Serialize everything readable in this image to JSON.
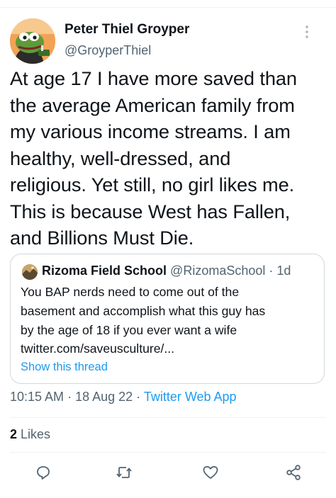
{
  "tweet": {
    "author": {
      "display_name": "Peter Thiel Groyper",
      "handle": "@GroyperThiel",
      "avatar_icon": "frog-avatar"
    },
    "text": "At age 17 I have more saved than\nthe average American family from\nmy various income streams. I am\nhealthy, well-dressed, and\nreligious. Yet still, no girl likes me.\nThis is because West has Fallen,\nand Billions Must Die.",
    "quoted": {
      "author_name": "Rizoma Field School",
      "author_handle": "@RizomaSchool",
      "separator": " · ",
      "age": "1d",
      "text": "You BAP nerds need to come out of the\nbasement and accomplish what this guy has\nby the age of 18 if you ever want a wife\ntwitter.com/saveusculture/...",
      "show_thread_label": "Show this thread"
    },
    "time": "10:15 AM",
    "date": "18 Aug 22",
    "separator": " · ",
    "app": "Twitter Web App",
    "likes_count": "2",
    "likes_label": "Likes"
  },
  "actions": [
    "reply-icon",
    "retweet-icon",
    "like-icon",
    "share-icon"
  ],
  "colors": {
    "text": "#0f1419",
    "secondary": "#536471",
    "accent": "#1d9bf0",
    "border": "#cfd9de"
  }
}
